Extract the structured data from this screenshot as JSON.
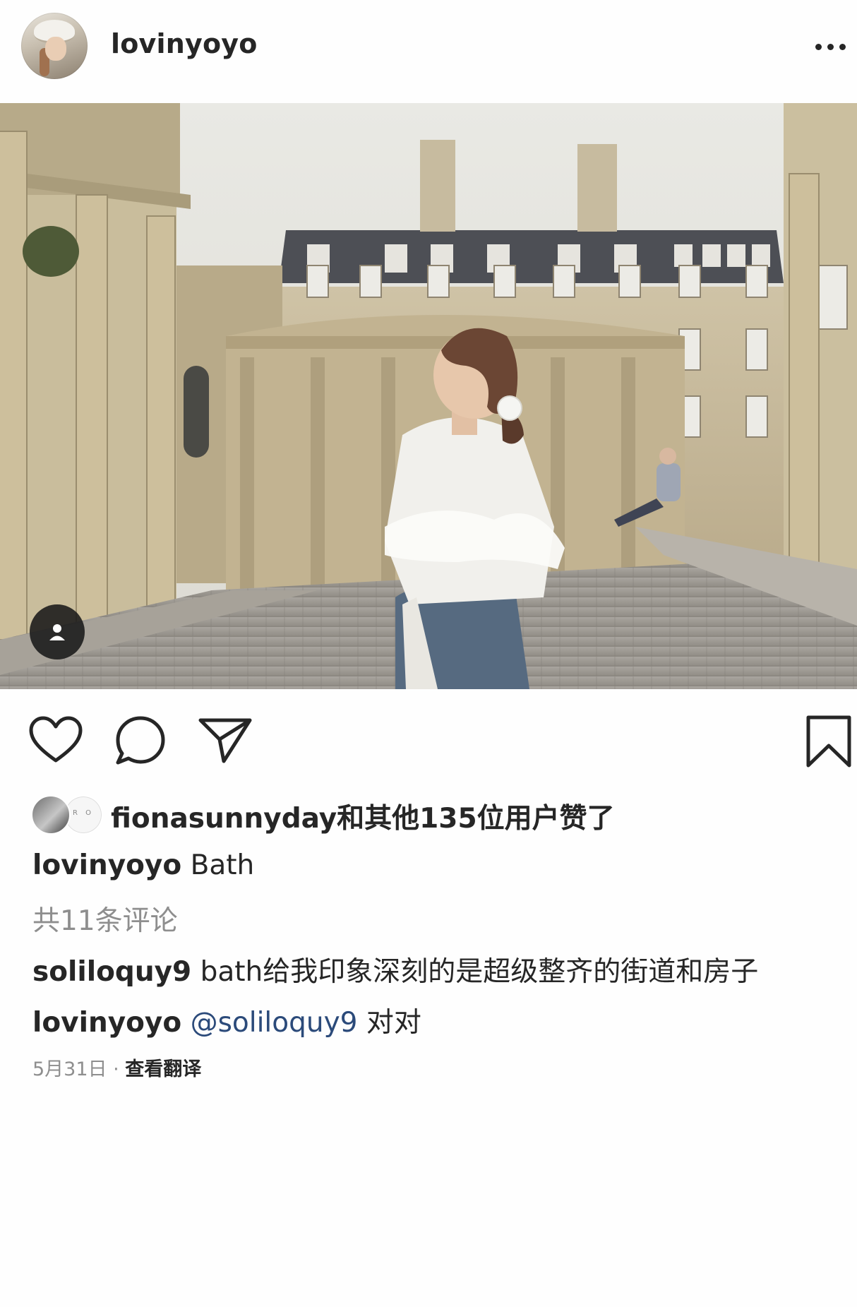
{
  "post": {
    "author": "lovinyoyo",
    "caption": "Bath"
  },
  "likes": {
    "user": "fionasunnyday",
    "text": "和其他135位用户赞了"
  },
  "comments": {
    "view_all": "共11条评论",
    "items": [
      {
        "user": "soliloquy9",
        "text": "bath给我印象深刻的是超级整齐的街道和房子"
      },
      {
        "user": "lovinyoyo",
        "mention": "@soliloquy9",
        "text": "对对"
      }
    ]
  },
  "meta": {
    "date": "5月31日",
    "separator": " · ",
    "translate": "查看翻译"
  },
  "icons": {
    "more": "more-icon",
    "tag": "user-tag-icon",
    "like": "heart-icon",
    "comment": "comment-icon",
    "share": "send-icon",
    "save": "bookmark-icon"
  },
  "colors": {
    "text": "#262626",
    "secondary": "#8e8e8e",
    "mention": "#2b4a7a"
  }
}
